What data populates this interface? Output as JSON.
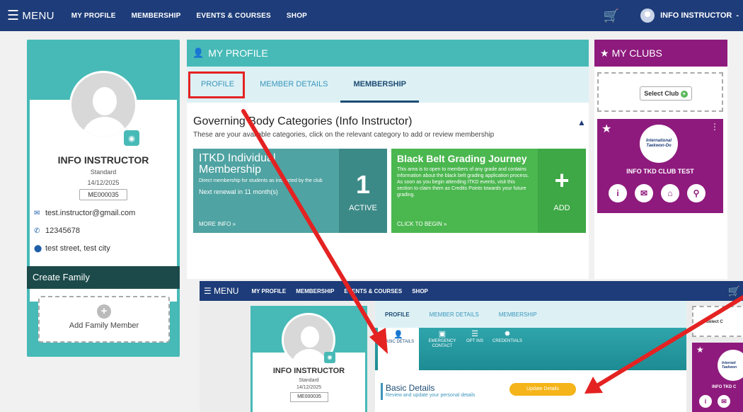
{
  "nav": {
    "menu_label": "MENU",
    "links": [
      "MY PROFILE",
      "MEMBERSHIP",
      "EVENTS & COURSES",
      "SHOP"
    ],
    "user_name": "INFO INSTRUCTOR",
    "user_caret": "-"
  },
  "profile_card": {
    "name": "INFO INSTRUCTOR",
    "level": "Standard",
    "date": "14/12/2025",
    "member_id": "ME000035",
    "email": "test.instructor@gmail.com",
    "phone": "12345678",
    "address": "test street, test city",
    "family_heading": "Create Family",
    "add_family_label": "Add Family Member"
  },
  "main_panel": {
    "heading": "MY PROFILE",
    "tabs": [
      {
        "label": "PROFILE"
      },
      {
        "label": "MEMBER DETAILS"
      },
      {
        "label": "MEMBERSHIP"
      }
    ],
    "active_tab": "MEMBERSHIP",
    "gb_title": "Governing Body Categories (Info Instructor)",
    "gb_subtitle": "These are your available categories, click on the relevant category to add or review membership",
    "cat1": {
      "title": "ITKD Individual Membership",
      "desc": "Direct membership for students as instructed by the club",
      "renewal": "Next renewal in 11 month(s)",
      "more": "MORE INFO »",
      "count": "1",
      "status": "ACTIVE"
    },
    "cat2": {
      "title": "Black Belt Grading Journey",
      "desc": "This area is to open to members of any grade and contains information about the black belt grading application process. As soon as you begin attending ITKD events, visit this section to claim them as Credits Points towards your future grading.",
      "more": "CLICK TO BEGIN »",
      "plus": "+",
      "action": "ADD"
    }
  },
  "clubs": {
    "heading": "MY CLUBS",
    "select_label": "Select Club",
    "logo_text": "International Taekwon-Do",
    "club_name": "INFO TKD CLUB TEST"
  },
  "inset": {
    "menu_label": "MENU",
    "links": [
      "MY PROFILE",
      "MEMBERSHIP",
      "EVENTS & COURSES",
      "SHOP"
    ],
    "name": "INFO INSTRUCTOR",
    "level": "Standard",
    "date": "14/12/2025",
    "member_id": "ME000035",
    "tabs": [
      "PROFILE",
      "MEMBER DETAILS",
      "MEMBERSHIP"
    ],
    "subtabs": [
      "BASIC DETAILS",
      "EMERGENCY CONTACT",
      "OPT INS",
      "CREDENTIALS"
    ],
    "basic_title": "Basic Details",
    "basic_sub": "Review and update your personal details",
    "update_btn": "Update Details",
    "select_label": "Select C",
    "logo_text": "Internati Taekwon",
    "club_name": "INFO TKD C"
  },
  "colors": {
    "nav": "#1d3c79",
    "teal": "#47bab7",
    "purple": "#8e1a7d",
    "green": "#4bb74f",
    "arrow_red": "#e42222",
    "update_yellow": "#f5b419"
  }
}
